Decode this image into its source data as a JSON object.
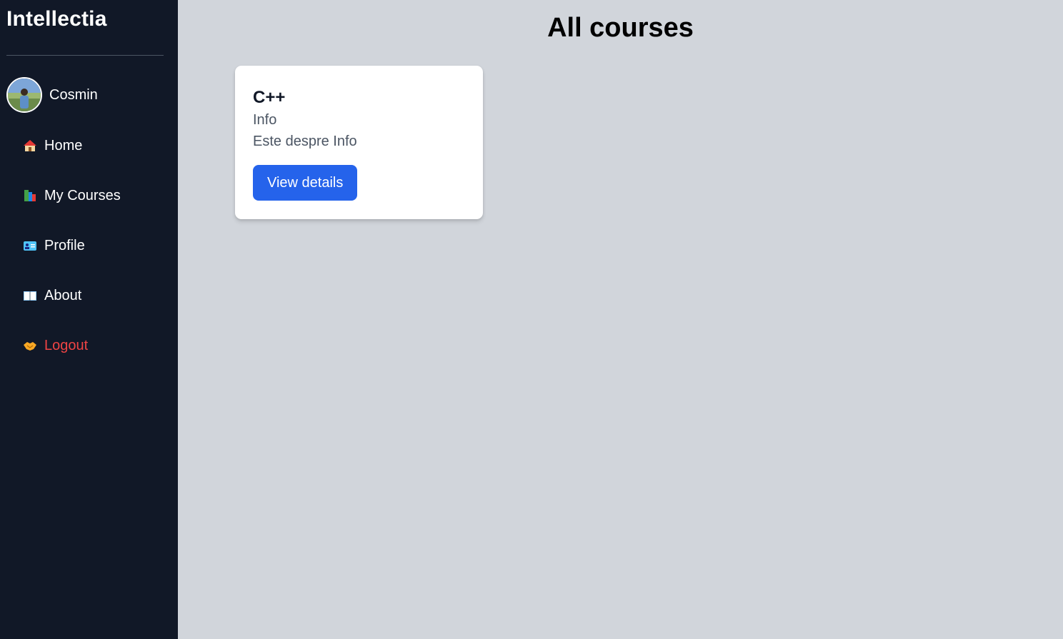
{
  "sidebar": {
    "brand": "Intellectia",
    "user": {
      "name": "Cosmin"
    },
    "items": [
      {
        "label": "Home",
        "icon": "house-icon"
      },
      {
        "label": "My Courses",
        "icon": "books-icon"
      },
      {
        "label": "Profile",
        "icon": "id-card-icon"
      },
      {
        "label": "About",
        "icon": "open-book-icon"
      },
      {
        "label": "Logout",
        "icon": "handshake-icon"
      }
    ]
  },
  "main": {
    "title": "All courses",
    "courses": [
      {
        "title": "C++",
        "category": "Info",
        "description": "Este despre Info",
        "button_label": "View details"
      }
    ]
  },
  "colors": {
    "sidebar_bg": "#111827",
    "main_bg": "#d1d5db",
    "accent": "#2563eb",
    "logout": "#ef4444"
  }
}
